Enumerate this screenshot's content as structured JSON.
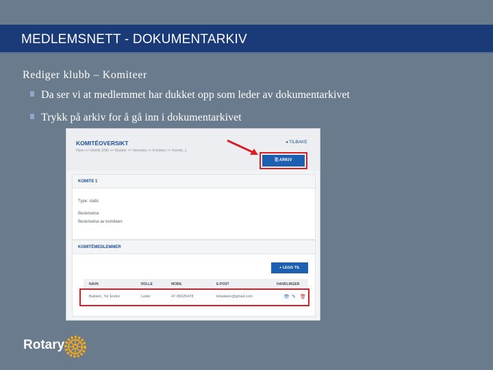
{
  "slide": {
    "title": "MEDLEMSNETT - DOKUMENTARKIV",
    "subtitle": "Rediger klubb – Komiteer",
    "bullets": [
      "Da ser vi at medlemmet har dukket opp som leder av dokumentarkivet",
      "Trykk på arkiv for å gå inn i dokumentarkivet"
    ],
    "logo_text": "Rotary",
    "colors": {
      "header_bg": "#1b3a78",
      "slide_bg": "#6a7b8d",
      "highlight": "#d81f25",
      "accent": "#1d5fb0",
      "logo_gold": "#f7a81b"
    }
  },
  "screenshot": {
    "page_title": "KOMITÉOVERSIKT",
    "breadcrumb": "Hjem >> Distrikt 2290 >> Klubber >> Vennesla >> Komiteer >> Komite_1",
    "back_label": "◂ TILBAKE",
    "arkiv_label": "ARKIV",
    "arkiv_icon": "archive-icon",
    "committee_heading": "KOMITE 1",
    "fields": [
      "Type: static",
      "Beskrivelse",
      "Beskrivelse av komiteen"
    ],
    "members_heading": "KOMITÉMEDLEMMER",
    "add_label": "+ LEGG TIL",
    "table": {
      "columns": [
        "NAVN",
        "ROLLE",
        "MOBIL",
        "E-POST",
        "HANDLINGER"
      ],
      "rows": [
        {
          "navn": "Bakken, Tor Endre",
          "rolle": "Leder",
          "mobil": "47-95025478",
          "epost": "tebakken@gmail.com"
        }
      ],
      "actions": [
        "view-icon",
        "edit-icon",
        "delete-icon"
      ]
    }
  }
}
